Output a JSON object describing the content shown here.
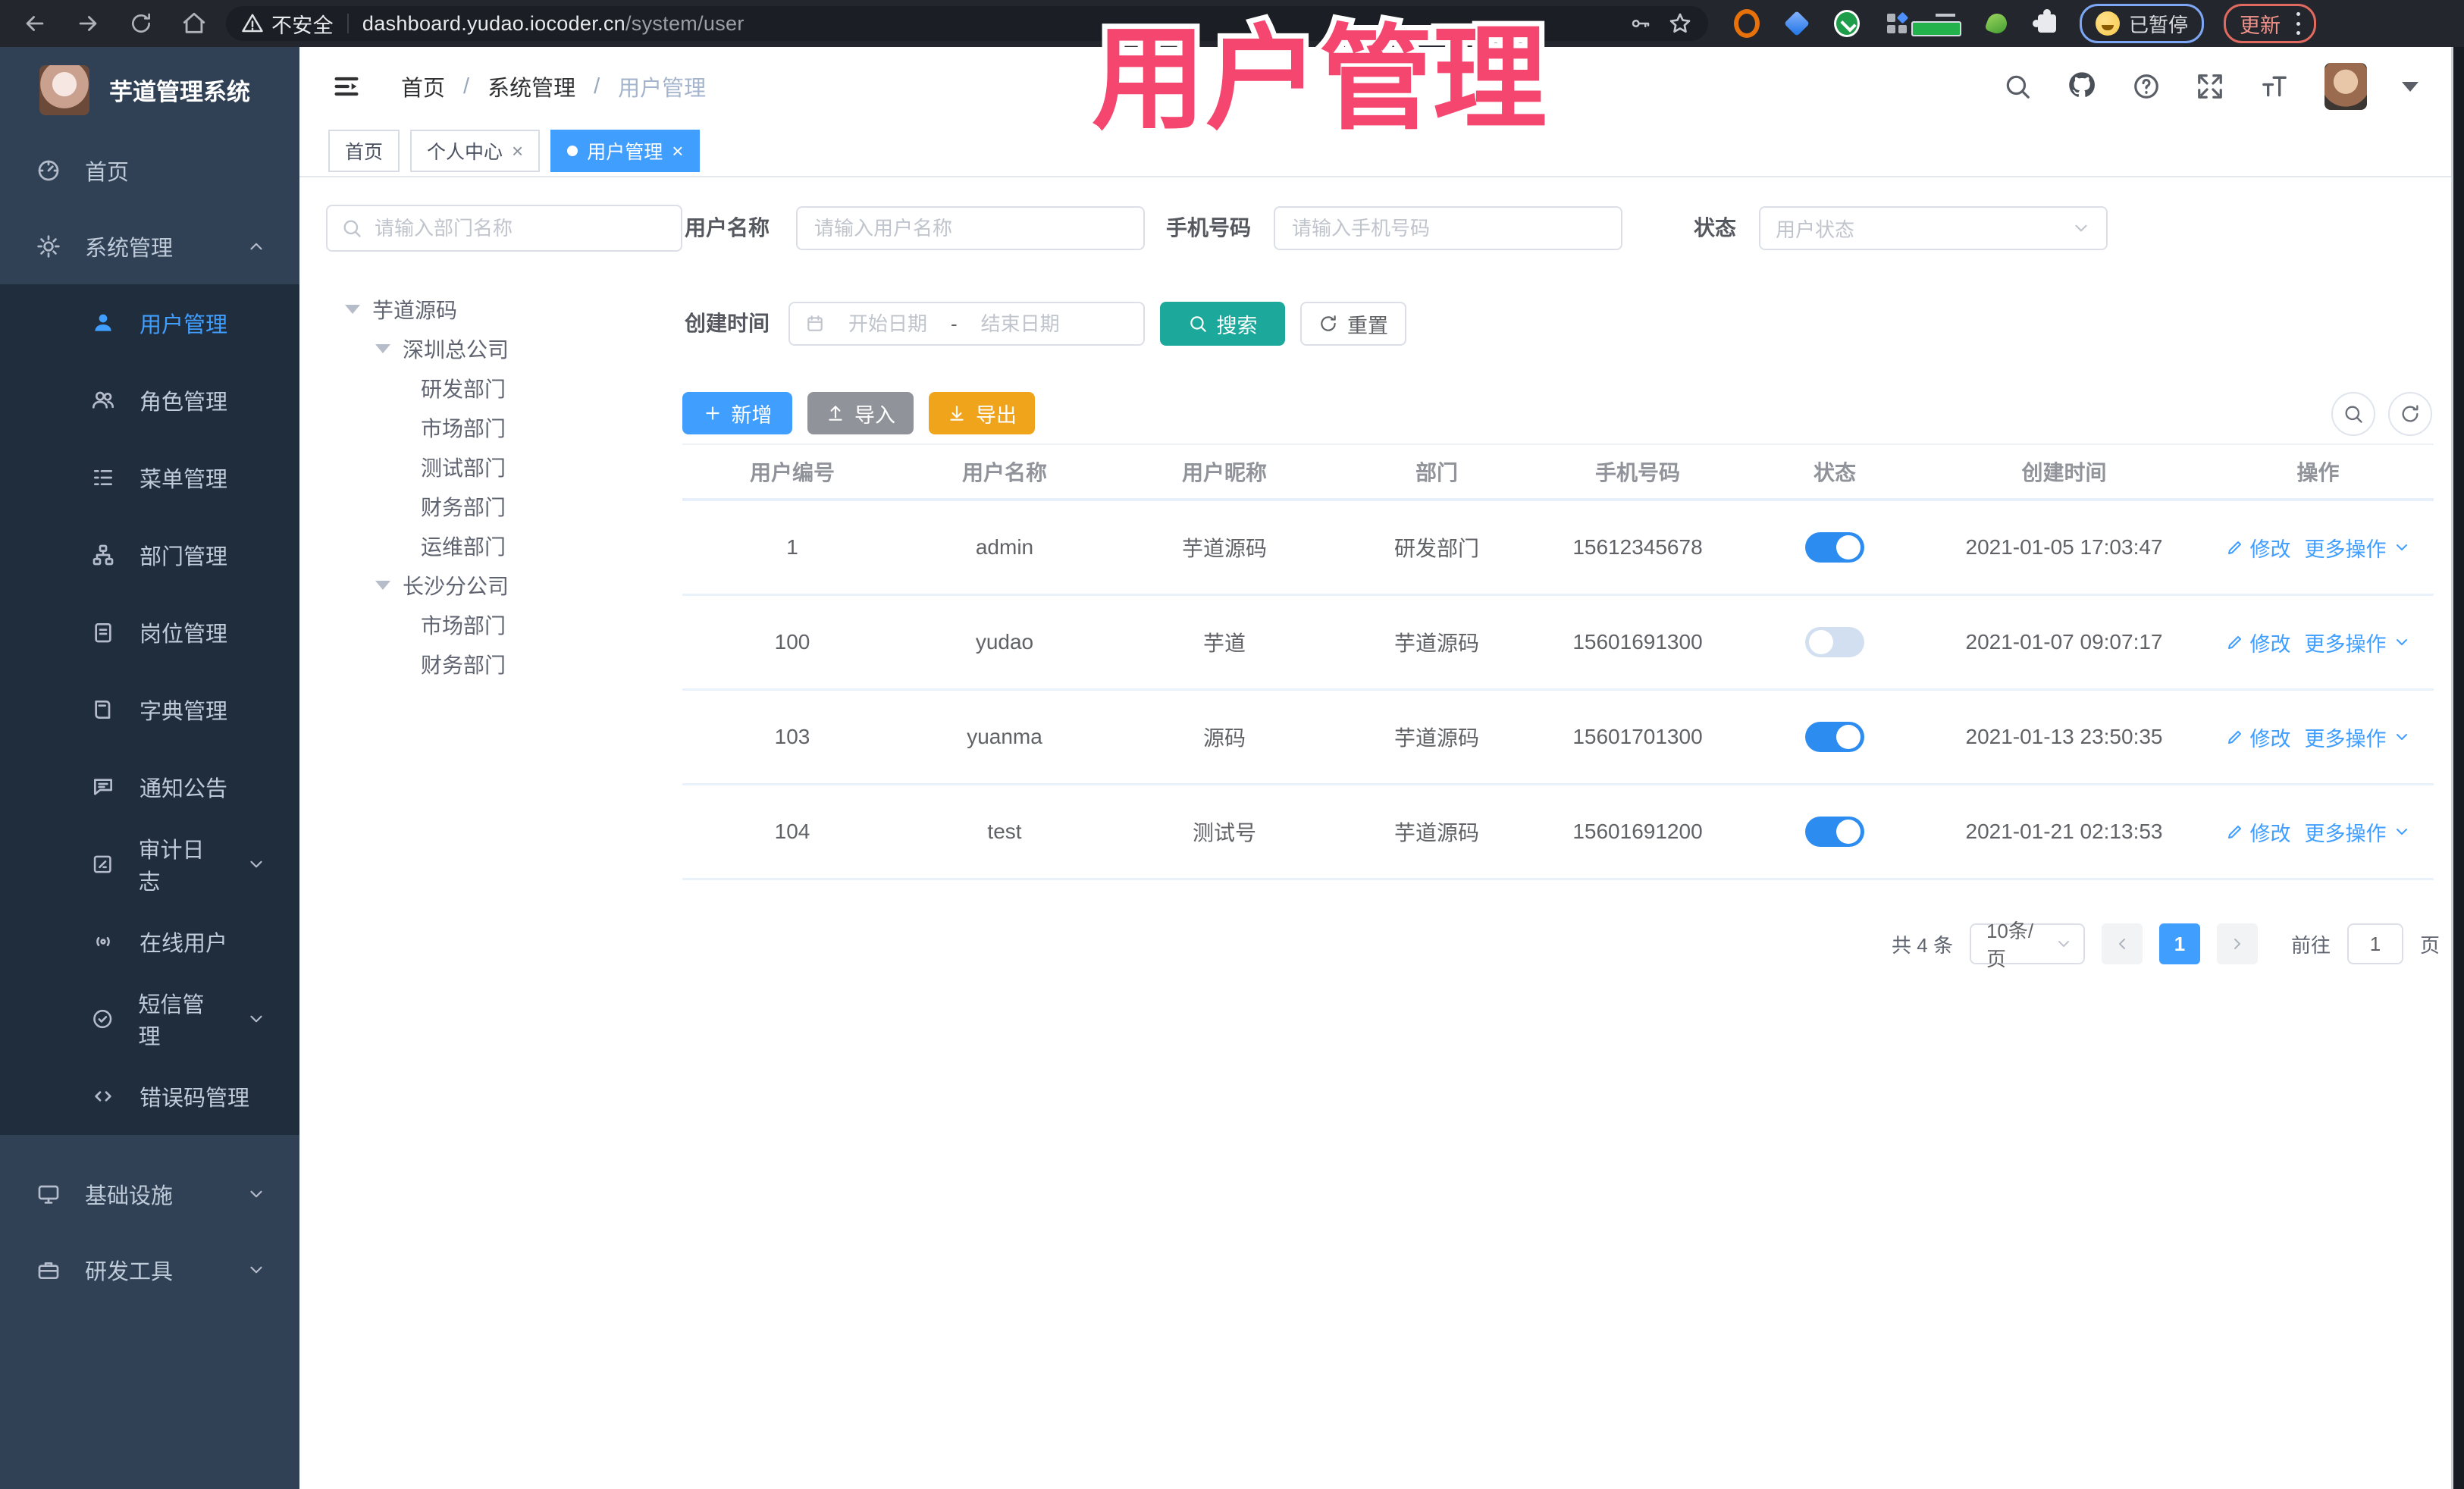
{
  "browser": {
    "security_label": "不安全",
    "url_domain": "dashboard.yudao.iocoder.cn",
    "url_path": "/system/user",
    "profile_status": "已暂停",
    "update_label": "更新"
  },
  "header": {
    "logo_title": "芋道管理系统",
    "breadcrumb": {
      "home": "首页",
      "section": "系统管理",
      "current": "用户管理",
      "separator": "/"
    }
  },
  "watermark": "用户管理",
  "tabs": {
    "home": "首页",
    "profile": "个人中心",
    "current": "用户管理",
    "close_glyph": "×"
  },
  "sidebar": {
    "menu": [
      {
        "label": "首页"
      },
      {
        "label": "系统管理"
      },
      {
        "label": "用户管理"
      },
      {
        "label": "角色管理"
      },
      {
        "label": "菜单管理"
      },
      {
        "label": "部门管理"
      },
      {
        "label": "岗位管理"
      },
      {
        "label": "字典管理"
      },
      {
        "label": "通知公告"
      },
      {
        "label": "审计日志"
      },
      {
        "label": "在线用户"
      },
      {
        "label": "短信管理"
      },
      {
        "label": "错误码管理"
      },
      {
        "label": "基础设施"
      },
      {
        "label": "研发工具"
      }
    ]
  },
  "dept_panel": {
    "search_placeholder": "请输入部门名称",
    "tree": [
      {
        "label": "芋道源码"
      },
      {
        "label": "深圳总公司"
      },
      {
        "label": "研发部门"
      },
      {
        "label": "市场部门"
      },
      {
        "label": "测试部门"
      },
      {
        "label": "财务部门"
      },
      {
        "label": "运维部门"
      },
      {
        "label": "长沙分公司"
      },
      {
        "label": "市场部门"
      },
      {
        "label": "财务部门"
      }
    ]
  },
  "filters": {
    "username_label": "用户名称",
    "username_placeholder": "请输入用户名称",
    "mobile_label": "手机号码",
    "mobile_placeholder": "请输入手机号码",
    "status_label": "状态",
    "status_placeholder": "用户状态",
    "create_time_label": "创建时间",
    "date_start_placeholder": "开始日期",
    "date_separator": "-",
    "date_end_placeholder": "结束日期",
    "search_button": "搜索",
    "reset_button": "重置"
  },
  "toolbar": {
    "add": "新增",
    "import": "导入",
    "export": "导出"
  },
  "table": {
    "headers": [
      "用户编号",
      "用户名称",
      "用户昵称",
      "部门",
      "手机号码",
      "状态",
      "创建时间",
      "操作"
    ],
    "edit_label": "修改",
    "more_label": "更多操作",
    "rows": [
      {
        "id": "1",
        "username": "admin",
        "nickname": "芋道源码",
        "dept": "研发部门",
        "mobile": "15612345678",
        "status_on": true,
        "created": "2021-01-05 17:03:47"
      },
      {
        "id": "100",
        "username": "yudao",
        "nickname": "芋道",
        "dept": "芋道源码",
        "mobile": "15601691300",
        "status_on": false,
        "created": "2021-01-07 09:07:17"
      },
      {
        "id": "103",
        "username": "yuanma",
        "nickname": "源码",
        "dept": "芋道源码",
        "mobile": "15601701300",
        "status_on": true,
        "created": "2021-01-13 23:50:35"
      },
      {
        "id": "104",
        "username": "test",
        "nickname": "测试号",
        "dept": "芋道源码",
        "mobile": "15601691200",
        "status_on": true,
        "created": "2021-01-21 02:13:53"
      }
    ]
  },
  "pagination": {
    "total": "共 4 条",
    "page_size": "10条/页",
    "page": "1",
    "goto_label": "前往",
    "goto_value": "1",
    "page_unit": "页"
  },
  "colors": {
    "accent": "#409EFF",
    "search_teal": "#1CA99C",
    "export_amber": "#EFA41C",
    "import_gray": "#909399",
    "watermark_pink": "#F5466F",
    "sidebar_bg": "#304156",
    "submenu_bg": "#1F2D3D"
  }
}
